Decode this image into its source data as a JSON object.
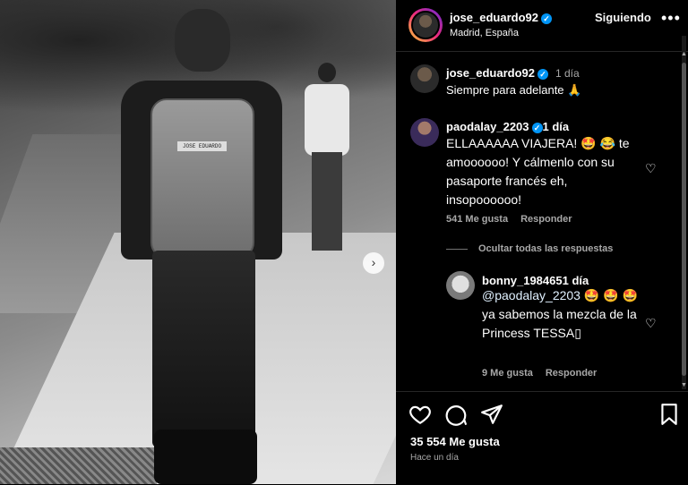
{
  "post": {
    "username": "jose_eduardo92",
    "location": "Madrid, España",
    "follow_label": "Siguiendo",
    "more_label": "•••",
    "backpack_tag": "JOSE EDUARDO",
    "carousel_next": "›"
  },
  "caption": {
    "username": "jose_eduardo92",
    "time": "1 día",
    "text": "Siempre para adelante 🙏"
  },
  "comments": [
    {
      "username": "paodalay_2203",
      "time": "1 día",
      "text": "ELLAAAAAA VIAJERA! 🤩 😂 te amoooooo! Y cálmenlo con su pasaporte francés eh, insopoooooo!",
      "likes": "541 Me gusta",
      "reply_label": "Responder"
    }
  ],
  "hide_replies_label": "Ocultar todas las respuestas",
  "reply": {
    "username": "bonny_198465",
    "time": "1 día",
    "mention": "@paodalay_2203",
    "text_after_mention": " 🤩 🤩 🤩 ya sabemos la mezcla de la Princess TESSA▯",
    "likes": "9 Me gusta",
    "reply_label": "Responder"
  },
  "footer": {
    "likes": "35 554 Me gusta",
    "time_ago": "Hace un día"
  },
  "icons": {
    "verified": "verified-badge-icon",
    "heart": "heart-icon",
    "comment": "comment-icon",
    "share": "share-icon",
    "save": "bookmark-icon"
  },
  "colors": {
    "verified": "#0095f6",
    "secondary_text": "#a8a8a8",
    "background": "#000000"
  }
}
